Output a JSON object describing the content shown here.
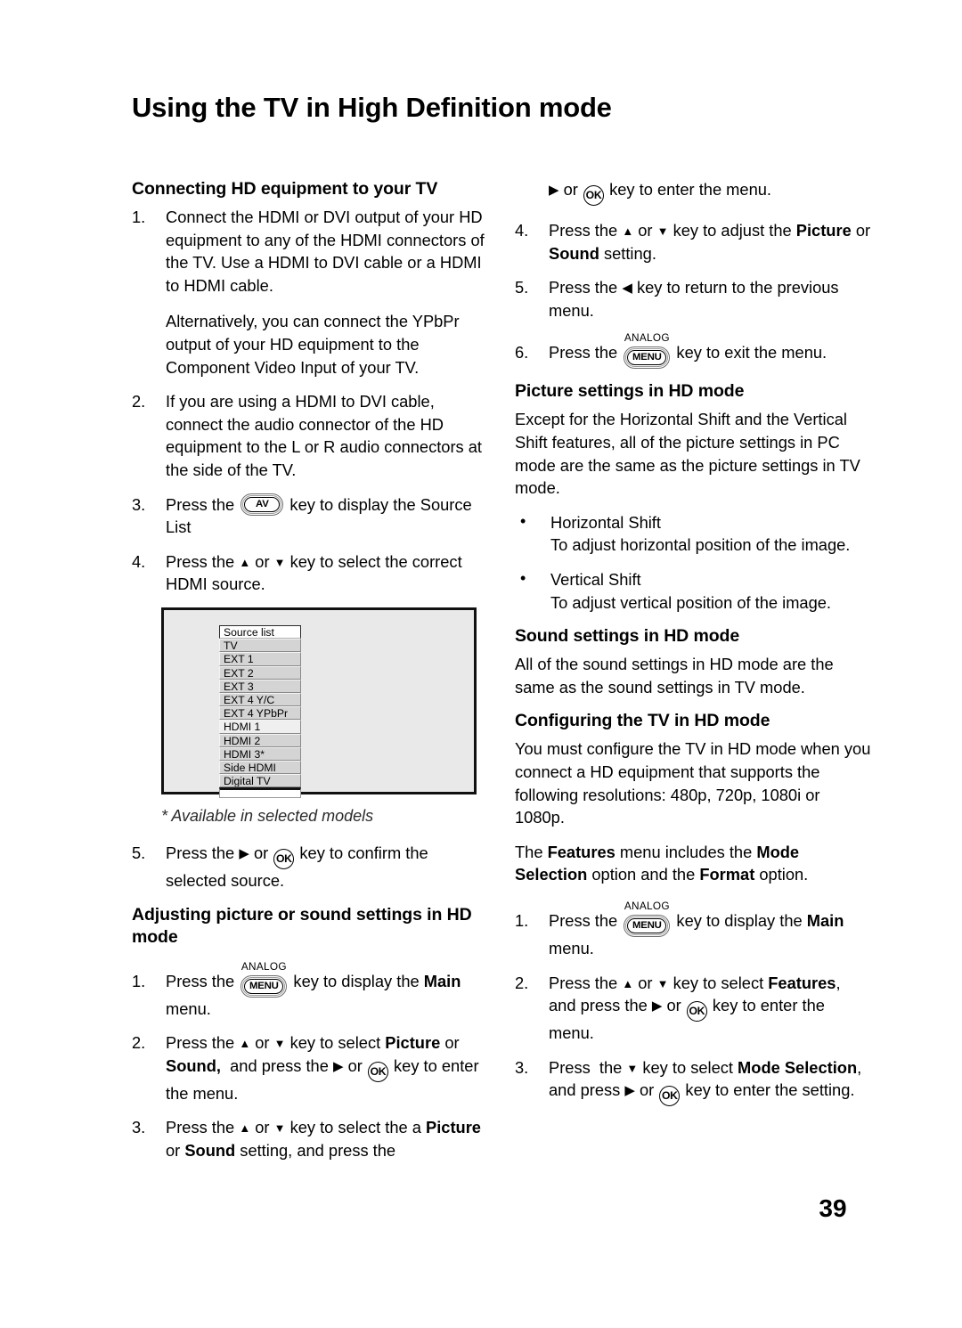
{
  "page": {
    "title": "Using the TV in High Definition mode",
    "number": "39"
  },
  "left_column": {
    "heading_connecting": "Connecting HD equipment to your TV",
    "steps": [
      {
        "num": "1.",
        "text": "Connect the HDMI or DVI output of your HD equipment to any of the HDMI connectors of the TV.  Use a HDMI to DVI cable or a HDMI to HDMI cable.",
        "sub": "Alternatively, you can connect the YPbPr output of your HD equipment to the Component Video Input of your TV."
      },
      {
        "num": "2.",
        "text": "If you are using a HDMI to DVI cable, connect the audio connector of the HD equipment to the L or R audio connectors at the side of the TV."
      },
      {
        "num": "3.",
        "text_before": "Press the",
        "key": "AV",
        "text_after": "key to display the Source List"
      },
      {
        "num": "4.",
        "text_before": "Press the",
        "text_after": "key to select the correct HDMI source."
      },
      {
        "num": "5.",
        "text_before": "Press the",
        "key": "OK",
        "text_after": "key to confirm the selected source."
      }
    ],
    "figure": {
      "list_header": "Source list",
      "items": [
        "TV",
        "EXT 1",
        "EXT 2",
        "EXT 3",
        "EXT 4 Y/C",
        "EXT 4 YPbPr",
        "HDMI 1",
        "HDMI 2",
        "HDMI 3*",
        "Side HDMI",
        "Digital TV"
      ],
      "selected_item": "HDMI 1",
      "caption": "* Available in selected models"
    },
    "heading_adjusting": "Adjusting picture or sound settings in HD mode",
    "adjust_steps": [
      {
        "num": "1.",
        "key_label": "ANALOG",
        "key": "MENU",
        "text_before": "Press the",
        "text_after_a": "key to display the",
        "bold_a": "Main",
        "text_after_b": "menu."
      },
      {
        "num": "2.",
        "text": "Press the ▲ or ▼ key to select Picture or Sound,  and press the ▶ or OK key to enter the menu."
      },
      {
        "num": "3.",
        "text": "Press the ▲ or ▼ key to select the a Picture or Sound setting, and press the"
      }
    ]
  },
  "right_column": {
    "continued": {
      "text_before": "or",
      "key": "OK",
      "text_after": "key to enter the menu."
    },
    "steps": [
      {
        "num": "4.",
        "text": "Press the ▲ or ▼ key to adjust the Picture or Sound setting."
      },
      {
        "num": "5.",
        "text": "Press the ◀ key to return to the previous menu."
      },
      {
        "num": "6.",
        "key_label": "ANALOG",
        "key": "MENU",
        "text_before": "Press the",
        "text_after": "key to exit the menu."
      }
    ],
    "heading_picture": "Picture settings in HD mode",
    "picture_intro": "Except for the Horizontal Shift and the Vertical Shift features, all of the picture settings in PC mode are the same as the picture settings in TV mode.",
    "bullets": [
      {
        "title": "Horizontal Shift",
        "desc": "To adjust horizontal position of the image."
      },
      {
        "title": "Vertical Shift",
        "desc": "To adjust vertical position of the image."
      }
    ],
    "heading_sound": "Sound settings in HD mode",
    "sound_intro": "All of the sound settings in HD mode are the same as the sound settings in TV mode.",
    "heading_configuring": "Configuring the TV in HD mode",
    "configuring_intro": "You must configure the TV in HD mode when you connect a HD equipment that supports the following resolutions: 480p, 720p, 1080i or 1080p.",
    "features_note": {
      "a": "The ",
      "b": "Features",
      "c": " menu includes the ",
      "d": "Mode Selection",
      "e": " option and the ",
      "f": "Format",
      "g": " option."
    },
    "config_steps": [
      {
        "num": "1.",
        "key_label": "ANALOG",
        "key": "MENU",
        "text_before": "Press the",
        "text_after_a": "key to display the",
        "bold_a": "Main",
        "text_after_b": "menu."
      },
      {
        "num": "2.",
        "text": "Press the ▲ or ▼ key to select Features, and press the ▶ or OK key to enter the menu."
      },
      {
        "num": "3.",
        "text": "Press  the ▼ key to select Mode Selection, and press ▶ or OK key to enter the setting."
      }
    ]
  },
  "icons": {
    "av_key": "av-key-icon",
    "ok_key": "ok-key-icon",
    "menu_key": "menu-key-icon",
    "arrow_up": "arrow-up-icon",
    "arrow_down": "arrow-down-icon",
    "arrow_left": "arrow-left-icon",
    "arrow_right": "arrow-right-icon"
  },
  "colors": {
    "text": "#000000",
    "figure_bg": "#e9e9e9",
    "figure_border": "#111111",
    "list_item_bg": "#d4d4d4",
    "list_selected_bg": "#efefef",
    "list_header_bg": "#ffffff",
    "caption_text": "#2b2b2b"
  }
}
